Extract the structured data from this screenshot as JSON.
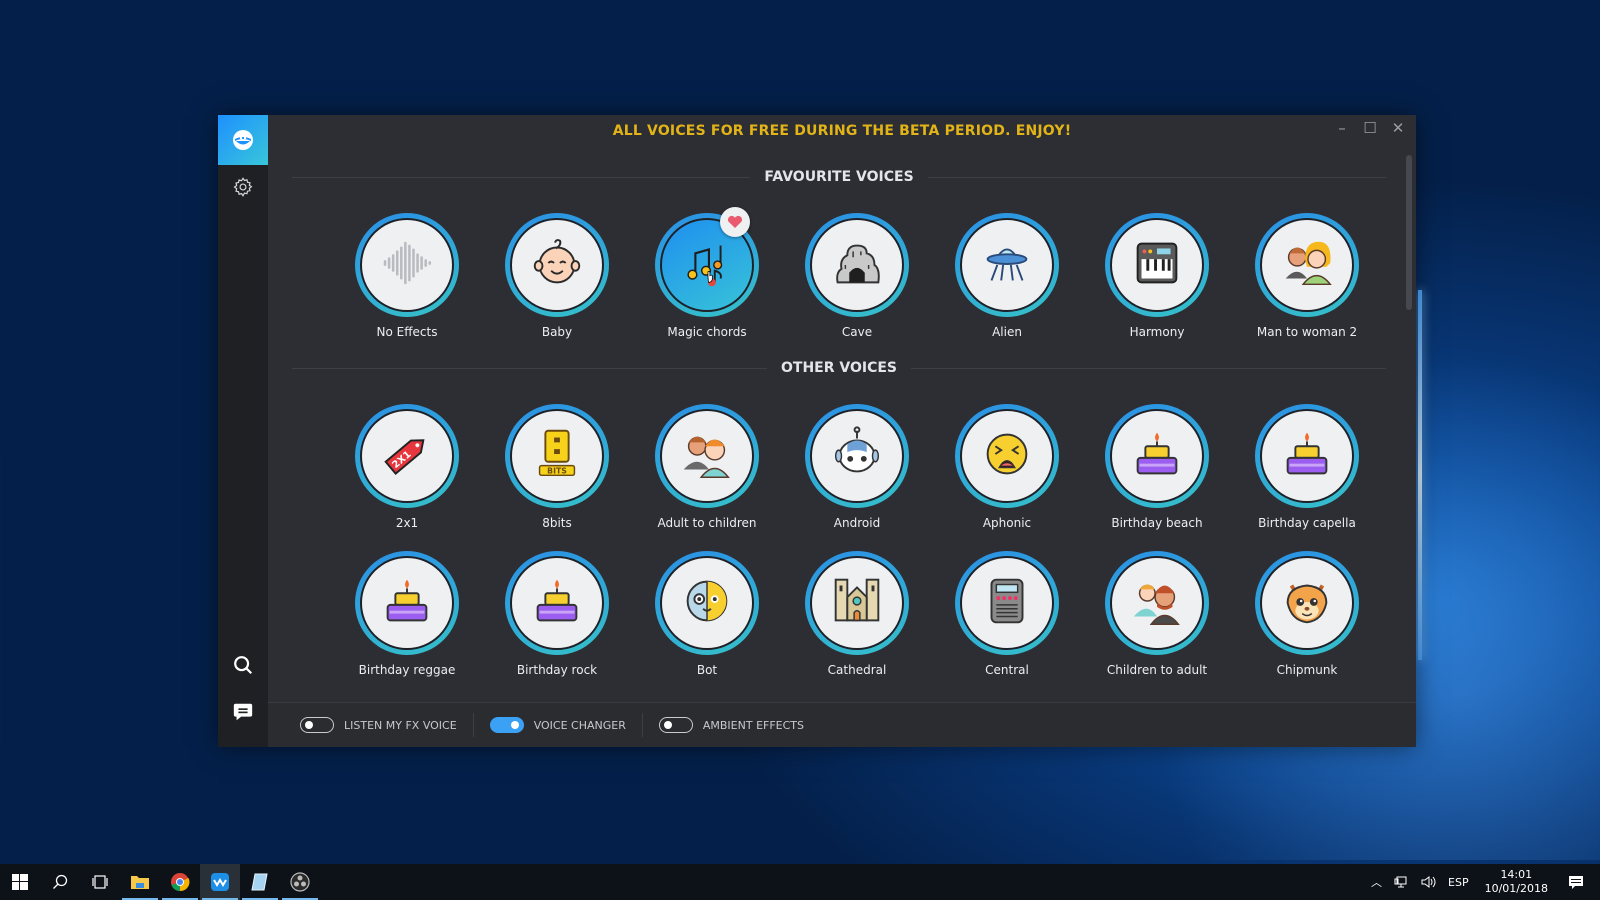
{
  "window": {
    "banner": "ALL VOICES FOR FREE DURING THE BETA PERIOD. ENJOY!",
    "controls": {
      "minimize": "–",
      "maximize": "☐",
      "close": "✕"
    }
  },
  "sidebar": {
    "items": [
      {
        "name": "voices",
        "icon": "open-mouth-logo-icon",
        "active": true
      },
      {
        "name": "settings",
        "icon": "gear-icon"
      },
      {
        "name": "search",
        "icon": "search-icon"
      },
      {
        "name": "feedback",
        "icon": "chat-icon"
      }
    ]
  },
  "sections": {
    "favourites": {
      "title": "FAVOURITE VOICES",
      "voices": [
        {
          "label": "No Effects",
          "icon": "sound-wave-icon"
        },
        {
          "label": "Baby",
          "icon": "baby-icon"
        },
        {
          "label": "Magic chords",
          "icon": "music-notes-icon",
          "selected": true,
          "favourite": true
        },
        {
          "label": "Cave",
          "icon": "cave-icon"
        },
        {
          "label": "Alien",
          "icon": "ufo-icon"
        },
        {
          "label": "Harmony",
          "icon": "synthesizer-icon"
        },
        {
          "label": "Man to woman 2",
          "icon": "man-to-woman-icon"
        }
      ]
    },
    "other": {
      "title": "OTHER VOICES",
      "voices": [
        {
          "label": "2x1",
          "icon": "price-tag-icon"
        },
        {
          "label": "8bits",
          "icon": "8bits-icon"
        },
        {
          "label": "Adult to children",
          "icon": "adult-to-children-icon"
        },
        {
          "label": "Android",
          "icon": "robot-head-icon"
        },
        {
          "label": "Aphonic",
          "icon": "tired-face-icon"
        },
        {
          "label": "Birthday beach",
          "icon": "birthday-cake-icon"
        },
        {
          "label": "Birthday capella",
          "icon": "birthday-cake-icon"
        },
        {
          "label": "Birthday reggae",
          "icon": "birthday-cake-icon"
        },
        {
          "label": "Birthday rock",
          "icon": "birthday-cake-icon"
        },
        {
          "label": "Bot",
          "icon": "half-robot-face-icon"
        },
        {
          "label": "Cathedral",
          "icon": "cathedral-icon"
        },
        {
          "label": "Central",
          "icon": "switchboard-icon"
        },
        {
          "label": "Children to adult",
          "icon": "children-to-adult-icon"
        },
        {
          "label": "Chipmunk",
          "icon": "chipmunk-icon"
        }
      ]
    }
  },
  "footer": {
    "toggles": [
      {
        "label": "LISTEN MY FX VOICE",
        "on": false
      },
      {
        "label": "VOICE CHANGER",
        "on": true
      },
      {
        "label": "AMBIENT EFFECTS",
        "on": false
      }
    ]
  },
  "taskbar": {
    "apps": [
      {
        "name": "start",
        "icon": "windows-logo-icon"
      },
      {
        "name": "search",
        "icon": "search-icon"
      },
      {
        "name": "task-view",
        "icon": "task-view-icon"
      },
      {
        "name": "file-explorer",
        "icon": "folder-icon",
        "running": true
      },
      {
        "name": "chrome",
        "icon": "chrome-icon",
        "running": true
      },
      {
        "name": "voicemod",
        "icon": "voicemod-icon",
        "running": true,
        "active": true
      },
      {
        "name": "notes",
        "icon": "notepad-icon",
        "running": true
      },
      {
        "name": "obs",
        "icon": "obs-icon",
        "running": true
      }
    ],
    "tray": {
      "language": "ESP",
      "time": "14:01",
      "date": "10/01/2018"
    }
  },
  "colors": {
    "accent": "#2a8fe6",
    "accent_teal": "#36c1c9",
    "banner": "#e3b417",
    "window_bg": "#2c2e33",
    "sidebar_bg": "#1f2023"
  }
}
